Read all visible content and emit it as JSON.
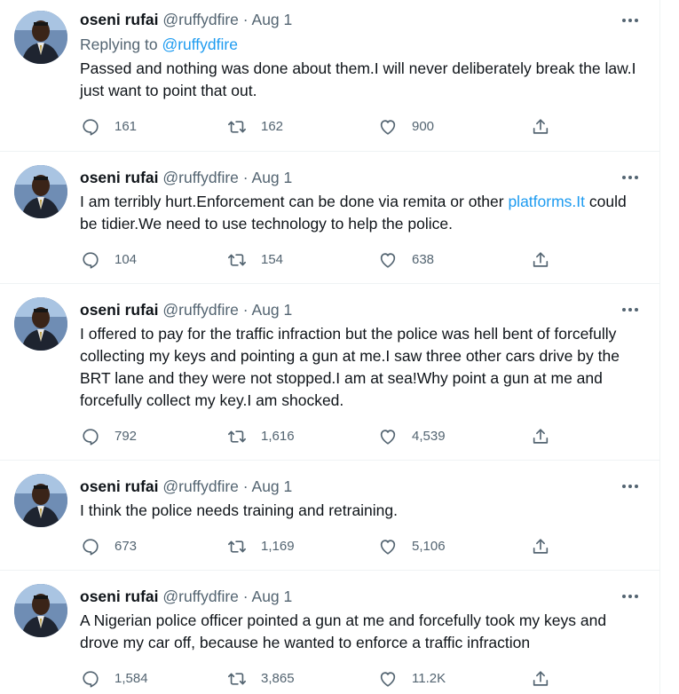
{
  "tweets": [
    {
      "name": "oseni rufai",
      "handle": "@ruffydfire",
      "separator": "·",
      "date": "Aug 1",
      "replying_prefix": "Replying to",
      "replying_handle": "@ruffydfire",
      "text": "Passed and nothing was done about them.I will never deliberately break the law.I just want to point that out.",
      "replies": "161",
      "retweets": "162",
      "likes": "900"
    },
    {
      "name": "oseni rufai",
      "handle": "@ruffydfire",
      "separator": "·",
      "date": "Aug 1",
      "text_before_link": "I am terribly hurt.Enforcement can be done via remita or other ",
      "text_link": "platforms.It",
      "text_after_link": " could be tidier.We need to use technology to help the police.",
      "replies": "104",
      "retweets": "154",
      "likes": "638"
    },
    {
      "name": "oseni rufai",
      "handle": "@ruffydfire",
      "separator": "·",
      "date": "Aug 1",
      "text": "I offered to pay for the traffic infraction but the police was hell bent of forcefully collecting my keys and pointing a gun at me.I saw three other cars drive by the BRT lane and they were not stopped.I am at sea!Why point a gun at me and forcefully collect my key.I am shocked.",
      "replies": "792",
      "retweets": "1,616",
      "likes": "4,539"
    },
    {
      "name": "oseni rufai",
      "handle": "@ruffydfire",
      "separator": "·",
      "date": "Aug 1",
      "text": "I think the police needs training and retraining.",
      "replies": "673",
      "retweets": "1,169",
      "likes": "5,106"
    },
    {
      "name": "oseni rufai",
      "handle": "@ruffydfire",
      "separator": "·",
      "date": "Aug 1",
      "text": "A Nigerian police officer pointed a gun at me and forcefully took my keys and drove my car off, because he wanted to enforce a traffic infraction",
      "replies": "1,584",
      "retweets": "3,865",
      "likes": "11.2K"
    }
  ],
  "icons": {
    "more": "more-icon",
    "reply": "reply-icon",
    "retweet": "retweet-icon",
    "like": "heart-icon",
    "share": "share-icon"
  },
  "colors": {
    "text": "#0f1419",
    "secondary": "#536471",
    "link": "#1d9bf0",
    "divider": "#eff3f4"
  }
}
